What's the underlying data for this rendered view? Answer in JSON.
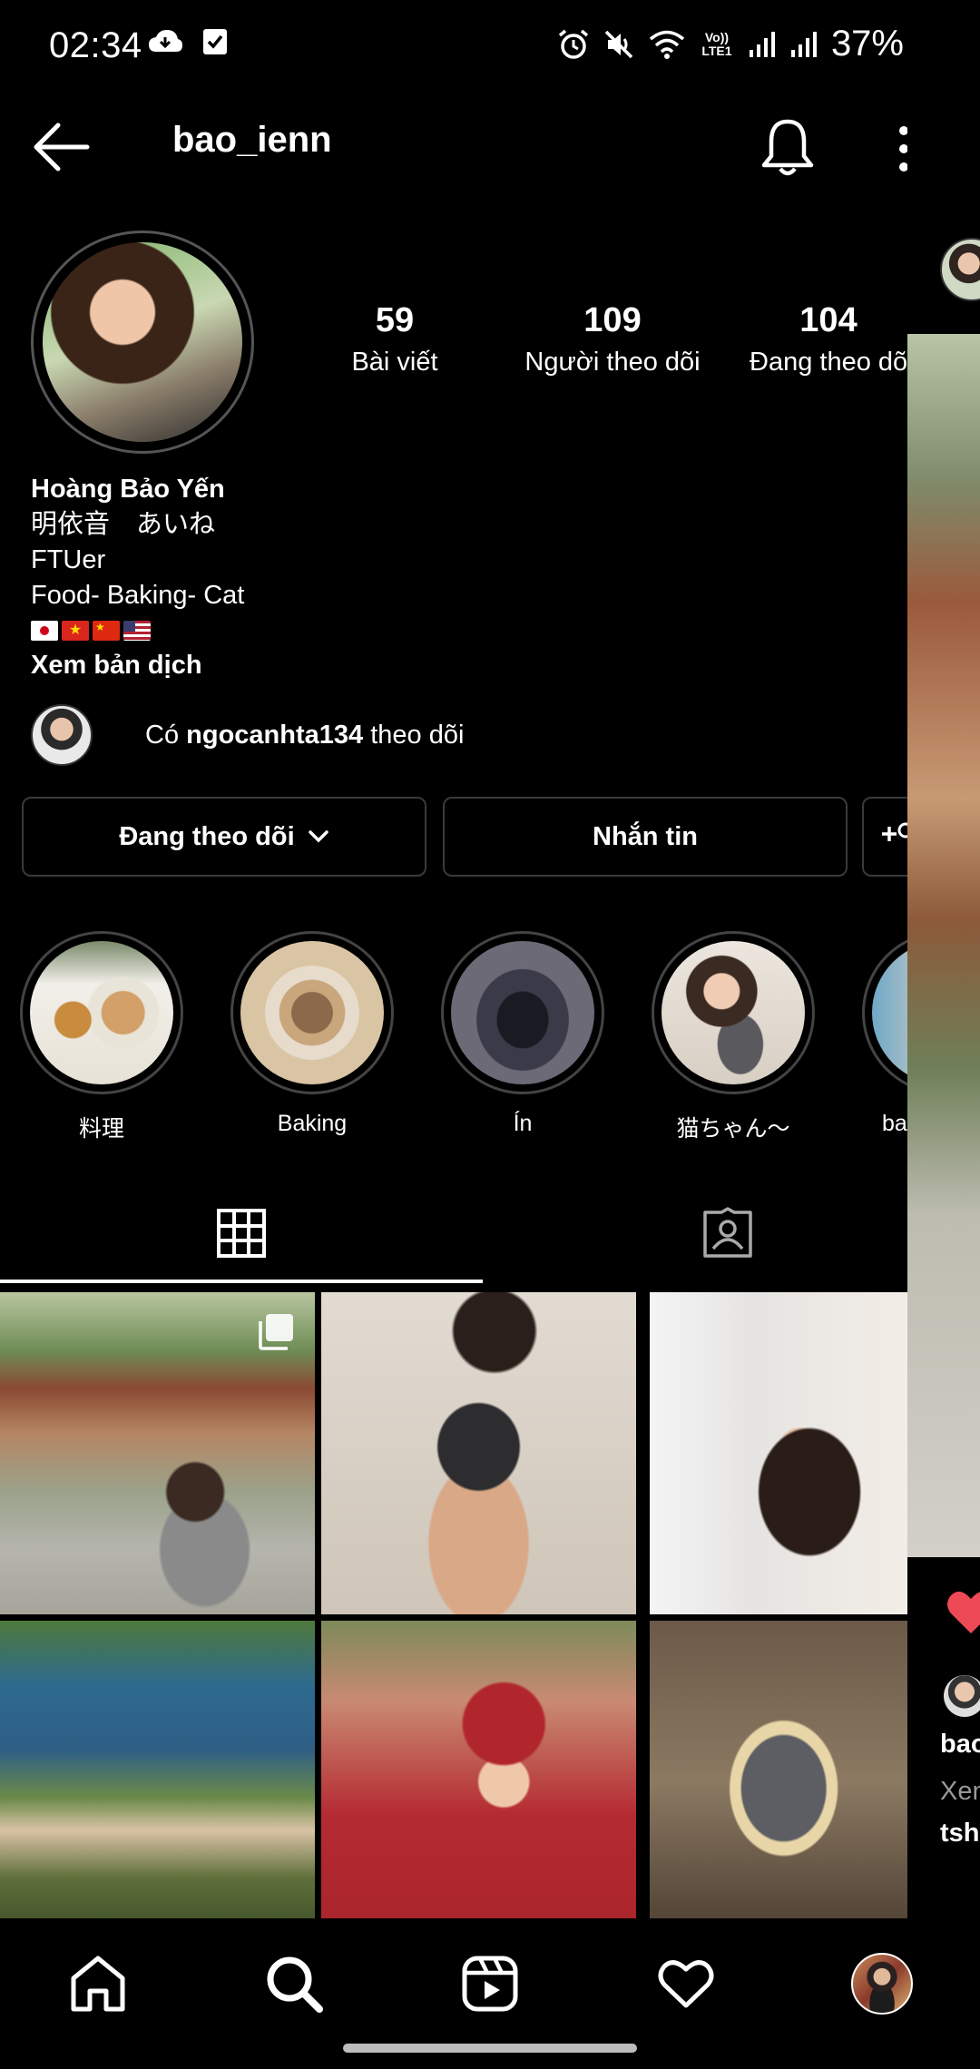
{
  "status_bar": {
    "time": "02:34",
    "battery": "37%",
    "icons": [
      "cloud-icon",
      "check-box-icon",
      "alarm-icon",
      "mute-icon",
      "wifi-icon",
      "volte-icon",
      "signal-icon",
      "signal-icon",
      "battery-icon"
    ],
    "volte_label": "Vo)) LTE1"
  },
  "header": {
    "username": "bao_ienn",
    "icons": [
      "back-arrow-icon",
      "bell-icon",
      "more-vertical-icon"
    ]
  },
  "stats": {
    "posts": {
      "value": "59",
      "label": "Bài viết"
    },
    "followers": {
      "value": "109",
      "label": "Người theo dõi"
    },
    "following": {
      "value": "104",
      "label": "Đang theo dõ"
    }
  },
  "bio": {
    "name": "Hoàng Bảo Yến",
    "line1": "明依音　あいね",
    "line2": "FTUer",
    "line3": "Food- Baking- Cat",
    "flags": [
      "japan-flag",
      "vietnam-flag",
      "china-flag",
      "usa-flag"
    ],
    "translate": "Xem bản dịch"
  },
  "mutual": {
    "prefix": "Có ",
    "user": "ngocanhta134",
    "suffix": " theo dõi"
  },
  "actions": {
    "following": "Đang theo dõi",
    "message": "Nhắn tin"
  },
  "highlights": [
    {
      "label": "料理"
    },
    {
      "label": "Baking"
    },
    {
      "label": "Ín"
    },
    {
      "label": "猫ちゃん〜"
    },
    {
      "label": "ba"
    }
  ],
  "tabs": [
    "grid-icon",
    "tagged-icon"
  ],
  "side_panel": {
    "user": "bao",
    "view": "Xen",
    "caption": "tshi"
  },
  "bottom_nav": [
    "home-icon",
    "search-icon",
    "reels-icon",
    "heart-icon",
    "profile-avatar"
  ],
  "colors": {
    "background": "#000000",
    "text": "#ffffff",
    "border": "#3a3a3a",
    "like_red": "#ed4956"
  }
}
